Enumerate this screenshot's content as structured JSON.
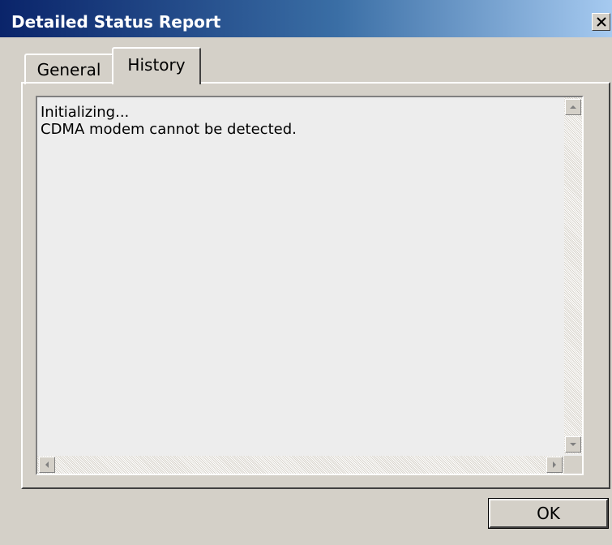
{
  "window": {
    "title": "Detailed Status Report"
  },
  "tabs": [
    {
      "label": "General",
      "selected": false
    },
    {
      "label": "History",
      "selected": true
    }
  ],
  "history": {
    "lines": [
      "Initializing...",
      "CDMA modem cannot be detected."
    ]
  },
  "buttons": {
    "ok_label": "OK"
  },
  "icons": {
    "close": "close-icon",
    "scroll_up": "arrow-up-icon",
    "scroll_down": "arrow-down-icon",
    "scroll_left": "arrow-left-icon",
    "scroll_right": "arrow-right-icon"
  },
  "colors": {
    "titlebar_start": "#0a246a",
    "titlebar_end": "#a6caf0",
    "dialog_face": "#d4d0c8",
    "text_area": "#ededed"
  }
}
